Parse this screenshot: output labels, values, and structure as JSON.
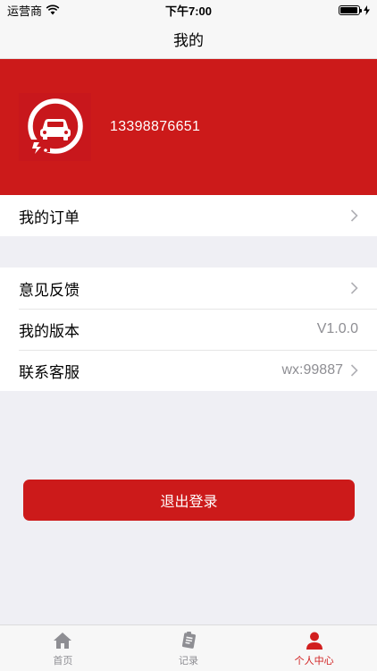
{
  "status": {
    "carrier": "运营商",
    "time": "下午7:00",
    "battery_percent": 95
  },
  "nav": {
    "title": "我的"
  },
  "profile": {
    "phone": "13398876651"
  },
  "menu_group_1": [
    {
      "label": "我的订单",
      "value": "",
      "chevron": true
    }
  ],
  "menu_group_2": [
    {
      "label": "意见反馈",
      "value": "",
      "chevron": true
    },
    {
      "label": "我的版本",
      "value": "V1.0.0",
      "chevron": false
    },
    {
      "label": "联系客服",
      "value": "wx:99887",
      "chevron": true
    }
  ],
  "logout_label": "退出登录",
  "tabs": [
    {
      "label": "首页",
      "icon": "home-icon",
      "active": false
    },
    {
      "label": "记录",
      "icon": "record-icon",
      "active": false
    },
    {
      "label": "个人中心",
      "icon": "person-icon",
      "active": true
    }
  ],
  "colors": {
    "accent": "#cc1a1a",
    "background": "#efeff4"
  }
}
